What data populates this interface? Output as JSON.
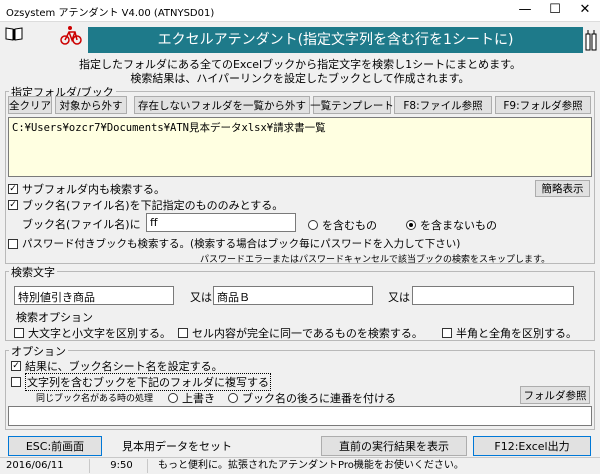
{
  "window": {
    "title": "Ozsystem アテンダント V4.00 (ATNYSD01)"
  },
  "banner": "エクセルアテンダント(指定文字列を含む行を1シートに)",
  "description": [
    "指定したフォルダにある全てのExcelブックから指定文字を検索し1シートにまとめます。",
    "検索結果は、ハイパーリンクを設定したブックとして作成されます。"
  ],
  "folder_section": {
    "legend": "指定フォルダ/ブック",
    "buttons": {
      "clear": "全クリア",
      "remove": "対象から外す",
      "remove_missing": "存在しないフォルダを一覧から外す",
      "template": "一覧テンプレート",
      "f8": "F8:ファイル参照",
      "f9": "F9:フォルダ参照"
    },
    "path": "C:¥Users¥ozcr7¥Documents¥ATN見本データxlsx¥請求書一覧",
    "simple_view": "簡略表示",
    "subfolder_label": "サブフォルダ内も検索する。",
    "subfolder_checked": true,
    "bookname_label": "ブック名(ファイル名)を下記指定のもののみとする。",
    "bookname_checked": true,
    "bookname_prefix": "ブック名(ファイル名)に",
    "bookname_value": "ff",
    "radio_include": "を含むもの",
    "radio_exclude": "を含まないもの",
    "radio_selected": "exclude",
    "password_label": "パスワード付きブックも検索する。(検索する場合はブック毎にパスワードを入力して下さい)",
    "password_checked": false,
    "password_note": "パスワードエラーまたはパスワードキャンセルで該当ブックの検索をスキップします。"
  },
  "search_section": {
    "legend": "検索文字",
    "term1": "特別値引き商品",
    "or1": "又は",
    "term2": "商品Ｂ",
    "or2": "又は",
    "term3": "",
    "options_label": "検索オプション",
    "opt_case": "大文字と小文字を区別する。",
    "opt_exact": "セル内容が完全に同一であるものを検索する。",
    "opt_width": "半角と全角を区別する。"
  },
  "options_section": {
    "legend": "オプション",
    "sheetname_label": "結果に、ブック名シート名を設定する。",
    "sheetname_checked": true,
    "copy_label": "文字列を含むブックを下記のフォルダに複写する",
    "copy_checked": false,
    "duplicate_label": "同じブック名がある時の処理",
    "overwrite": "上書き",
    "serial": "ブック名の後ろに連番を付ける",
    "folder_ref": "フォルダ参照",
    "copy_path": ""
  },
  "bottom_buttons": {
    "esc": "ESC:前画面",
    "sample": "見本用データをセット",
    "last_result": "直前の実行結果を表示",
    "f12": "F12:Excel出力"
  },
  "status": {
    "date": "2016/06/11",
    "time": "9:50",
    "message": "もっと便利に。拡張されたアテンダントPro機能をお使いください。"
  },
  "icons": [
    "book-icon",
    "bicycle-icon",
    "help-icon"
  ]
}
